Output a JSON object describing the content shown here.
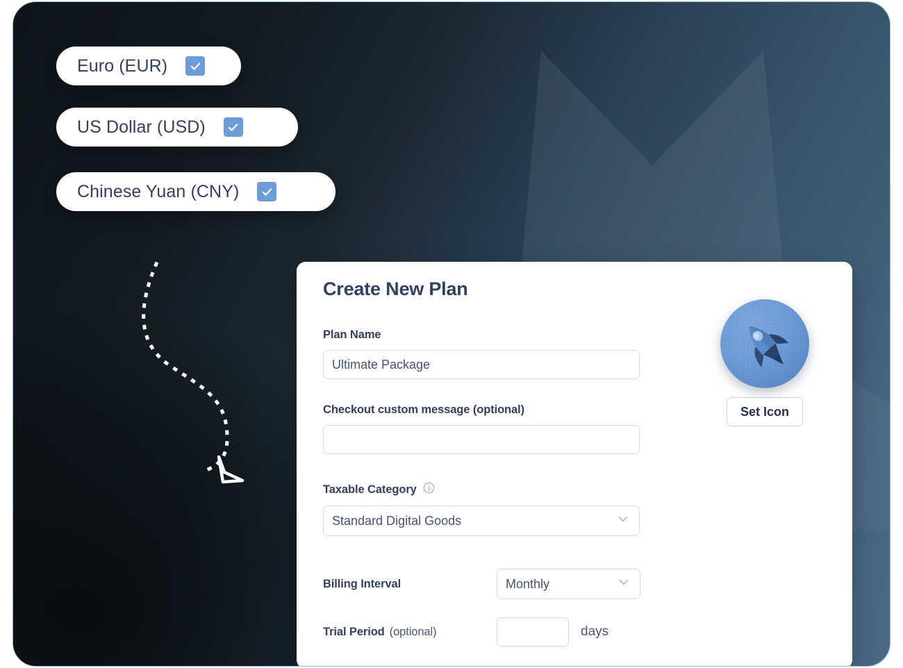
{
  "currency_pills": [
    {
      "label": "Euro (EUR)",
      "checked": true,
      "icon": "check-icon"
    },
    {
      "label": "US Dollar (USD)",
      "checked": true,
      "icon": "check-icon"
    },
    {
      "label": "Chinese Yuan (CNY)",
      "checked": true,
      "icon": "check-icon"
    }
  ],
  "card": {
    "title": "Create New Plan",
    "plan_name": {
      "label": "Plan Name",
      "value": "Ultimate Package",
      "placeholder": ""
    },
    "checkout_message": {
      "label": "Checkout custom message (optional)",
      "value": "",
      "placeholder": ""
    },
    "taxable_category": {
      "label": "Taxable Category",
      "info_icon": "info-circle-icon",
      "value": "Standard Digital Goods",
      "chevron": "chevron-down-icon"
    },
    "billing_interval": {
      "label": "Billing Interval",
      "value": "Monthly",
      "chevron": "chevron-down-icon"
    },
    "trial_period": {
      "label": "Trial Period",
      "optional_label": "(optional)",
      "value": "",
      "placeholder": "",
      "unit": "days"
    },
    "icon_picker": {
      "badge_icon": "rocket-icon",
      "button_label": "Set Icon"
    }
  },
  "decor": {
    "burst_shape": "star-burst-shape",
    "arrow": "dotted-curved-arrow"
  },
  "colors": {
    "accent_blue": "#6d9cd9",
    "text_navy": "#32405f",
    "text_slate": "#46536f",
    "card_bg": "#ffffff",
    "frame_dark": "#0e1418",
    "frame_light": "#4a6987",
    "input_border": "#d6dae1"
  }
}
